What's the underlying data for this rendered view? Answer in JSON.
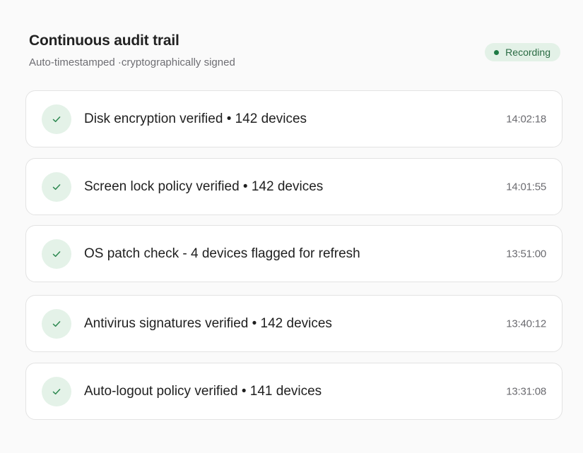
{
  "header": {
    "title": "Continuous audit trail",
    "subtitle": "Auto-timestamped ·cryptographically signed",
    "badge": {
      "label": "Recording",
      "color": "#1e7a44",
      "background": "#e3f1e7"
    }
  },
  "entries": [
    {
      "icon": "check-icon",
      "text": "Disk encryption verified • 142 devices",
      "time": "14:02:18"
    },
    {
      "icon": "check-icon",
      "text": "Screen lock policy verified • 142 devices",
      "time": "14:01:55"
    },
    {
      "icon": "check-icon",
      "text": "OS patch check - 4 devices flagged for refresh",
      "time": "13:51:00"
    },
    {
      "icon": "check-icon",
      "text": "Antivirus signatures verified • 142 devices",
      "time": "13:40:12"
    },
    {
      "icon": "check-icon",
      "text": "Auto-logout policy verified • 141 devices",
      "time": "13:31:08"
    }
  ],
  "colors": {
    "accent": "#1e7a44",
    "check_bg": "#e4f2e8",
    "card_border": "#e3e3e3"
  }
}
